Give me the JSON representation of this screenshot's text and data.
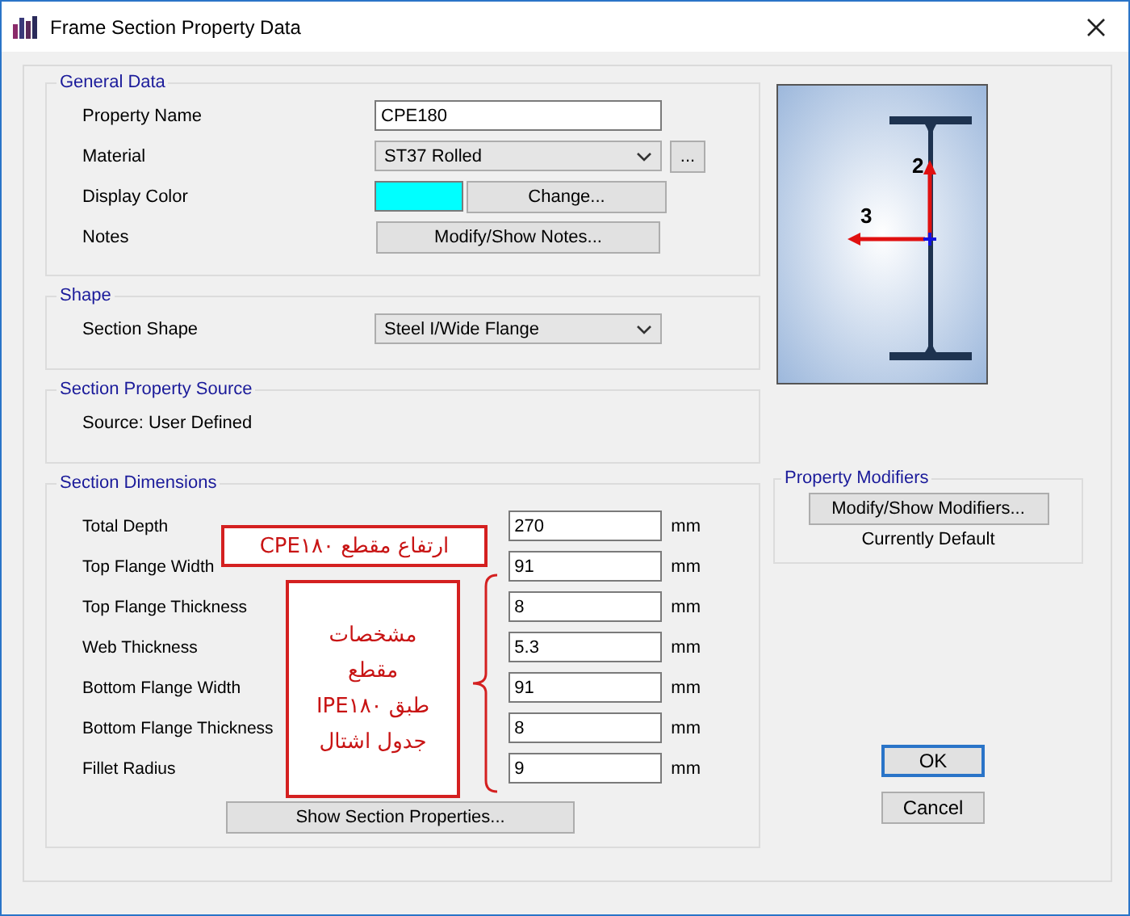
{
  "window": {
    "title": "Frame Section Property Data"
  },
  "general_data": {
    "title": "General Data",
    "property_name": {
      "label": "Property Name",
      "value": "CPE180"
    },
    "material": {
      "label": "Material",
      "value": "ST37 Rolled",
      "more_button": "..."
    },
    "display_color": {
      "label": "Display Color",
      "color": "#00ffff",
      "button": "Change..."
    },
    "notes": {
      "label": "Notes",
      "button": "Modify/Show Notes..."
    }
  },
  "shape": {
    "title": "Shape",
    "label": "Section Shape",
    "value": "Steel I/Wide Flange"
  },
  "source": {
    "title": "Section Property Source",
    "text": "Source:  User Defined"
  },
  "dimensions": {
    "title": "Section Dimensions",
    "rows": [
      {
        "label": "Total Depth",
        "value": "270",
        "unit": "mm"
      },
      {
        "label": "Top Flange Width",
        "value": "91",
        "unit": "mm"
      },
      {
        "label": "Top Flange Thickness",
        "value": "8",
        "unit": "mm"
      },
      {
        "label": "Web Thickness",
        "value": "5.3",
        "unit": "mm"
      },
      {
        "label": "Bottom Flange Width",
        "value": "91",
        "unit": "mm"
      },
      {
        "label": "Bottom Flange Thickness",
        "value": "8",
        "unit": "mm"
      },
      {
        "label": "Fillet Radius",
        "value": "9",
        "unit": "mm"
      }
    ],
    "button": "Show Section Properties...",
    "annotations": [
      {
        "kind": "label",
        "lines": [
          "ارتفاع مقطع CPE۱۸۰"
        ]
      },
      {
        "kind": "bracketed",
        "lines": [
          "مشخصات",
          "مقطع",
          "طبق IPE۱۸۰",
          "جدول اشتال"
        ]
      }
    ]
  },
  "preview": {
    "axis_labels": [
      "2",
      "3"
    ]
  },
  "property_modifiers": {
    "title": "Property Modifiers",
    "button": "Modify/Show Modifiers...",
    "status": "Currently Default"
  },
  "buttons": [
    {
      "label": "OK",
      "default": true
    },
    {
      "label": "Cancel",
      "default": false
    }
  ]
}
